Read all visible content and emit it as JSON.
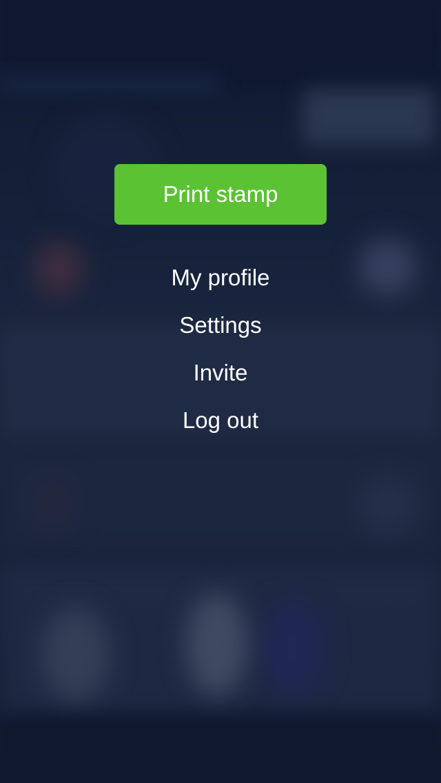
{
  "colors": {
    "primary_button": "#5bc234",
    "menu_text": "#ffffff",
    "background": "#16213a"
  },
  "menu": {
    "primary_action_label": "Print stamp",
    "items": [
      {
        "label": "My profile"
      },
      {
        "label": "Settings"
      },
      {
        "label": "Invite"
      },
      {
        "label": "Log out"
      }
    ]
  }
}
